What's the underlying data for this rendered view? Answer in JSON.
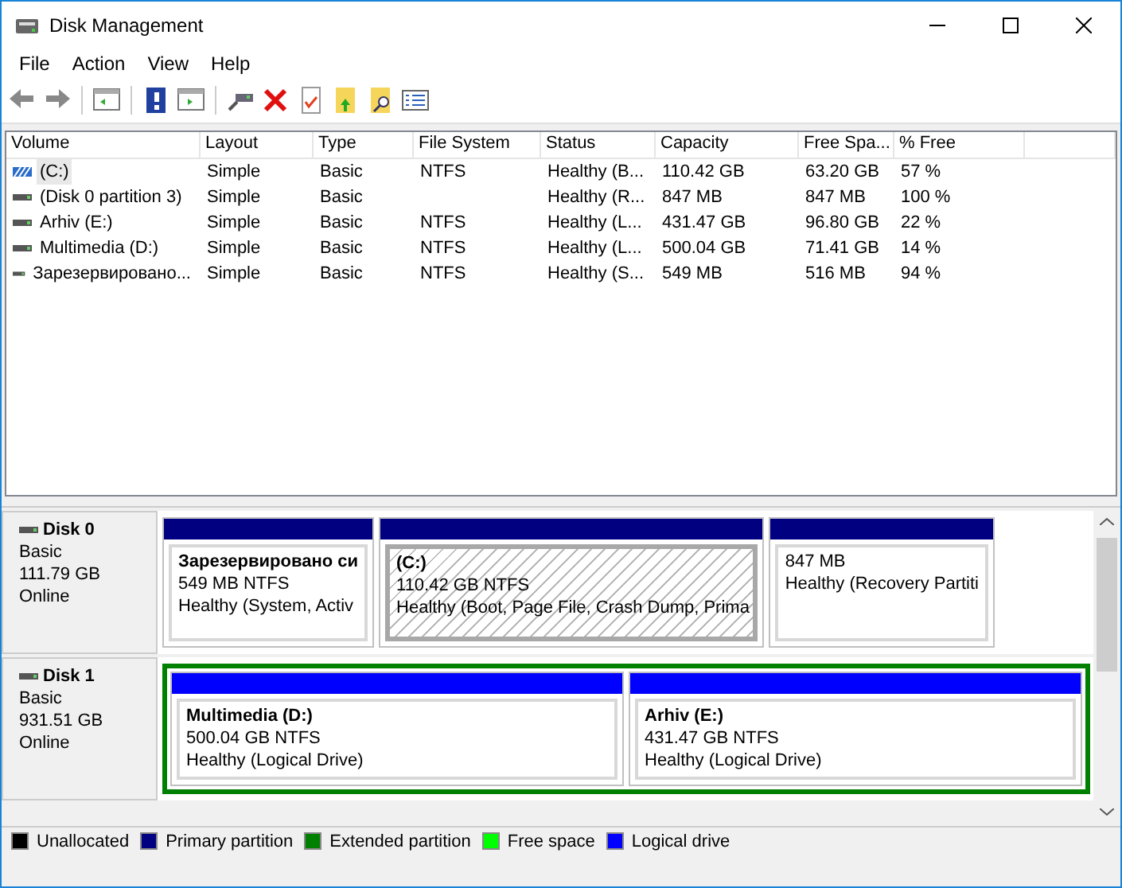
{
  "window": {
    "title": "Disk Management"
  },
  "menu": [
    "File",
    "Action",
    "View",
    "Help"
  ],
  "toolbar": [
    {
      "kind": "back"
    },
    {
      "kind": "forward"
    },
    {
      "kind": "sep"
    },
    {
      "kind": "pane"
    },
    {
      "kind": "sep"
    },
    {
      "kind": "help"
    },
    {
      "kind": "pane2"
    },
    {
      "kind": "sep"
    },
    {
      "kind": "connect"
    },
    {
      "kind": "delete"
    },
    {
      "kind": "check"
    },
    {
      "kind": "up"
    },
    {
      "kind": "find"
    },
    {
      "kind": "list"
    }
  ],
  "table": {
    "columns": [
      "Volume",
      "Layout",
      "Type",
      "File System",
      "Status",
      "Capacity",
      "Free Spa...",
      "% Free"
    ],
    "rows": [
      {
        "selected": true,
        "cells": [
          "(C:)",
          "Simple",
          "Basic",
          "NTFS",
          "Healthy (B...",
          "110.42 GB",
          "63.20 GB",
          "57 %"
        ]
      },
      {
        "selected": false,
        "cells": [
          "(Disk 0 partition 3)",
          "Simple",
          "Basic",
          "",
          "Healthy (R...",
          "847 MB",
          "847 MB",
          "100 %"
        ]
      },
      {
        "selected": false,
        "cells": [
          "Arhiv (E:)",
          "Simple",
          "Basic",
          "NTFS",
          "Healthy (L...",
          "431.47 GB",
          "96.80 GB",
          "22 %"
        ]
      },
      {
        "selected": false,
        "cells": [
          "Multimedia (D:)",
          "Simple",
          "Basic",
          "NTFS",
          "Healthy (L...",
          "500.04 GB",
          "71.41 GB",
          "14 %"
        ]
      },
      {
        "selected": false,
        "cells": [
          "Зарезервировано...",
          "Simple",
          "Basic",
          "NTFS",
          "Healthy (S...",
          "549 MB",
          "516 MB",
          "94 %"
        ]
      }
    ]
  },
  "disks": [
    {
      "name": "Disk 0",
      "type": "Basic",
      "size": "111.79 GB",
      "state": "Online",
      "partitions": [
        {
          "kind": "primary",
          "selected": false,
          "label": "Зарезервировано си",
          "size": "549 MB NTFS",
          "status": "Healthy (System, Activ"
        },
        {
          "kind": "primary",
          "selected": true,
          "label": "(C:)",
          "size": "110.42 GB NTFS",
          "status": "Healthy (Boot, Page File, Crash Dump, Prima"
        },
        {
          "kind": "primary",
          "selected": false,
          "size": "847 MB",
          "status": "Healthy (Recovery Partiti"
        }
      ]
    },
    {
      "name": "Disk 1",
      "type": "Basic",
      "size": "931.51 GB",
      "state": "Online",
      "partitions": [
        {
          "kind": "extended",
          "children": [
            {
              "kind": "logical",
              "selected": false,
              "label": "Multimedia  (D:)",
              "size": "500.04 GB NTFS",
              "status": "Healthy (Logical Drive)"
            },
            {
              "kind": "logical",
              "selected": false,
              "label": "Arhiv  (E:)",
              "size": "431.47 GB NTFS",
              "status": "Healthy (Logical Drive)"
            }
          ]
        }
      ]
    }
  ],
  "legend": [
    {
      "label": "Unallocated",
      "color": "#000000"
    },
    {
      "label": "Primary partition",
      "color": "#000080"
    },
    {
      "label": "Extended partition",
      "color": "#008000"
    },
    {
      "label": "Free space",
      "color": "#00ff00"
    },
    {
      "label": "Logical drive",
      "color": "#0000ff"
    }
  ]
}
